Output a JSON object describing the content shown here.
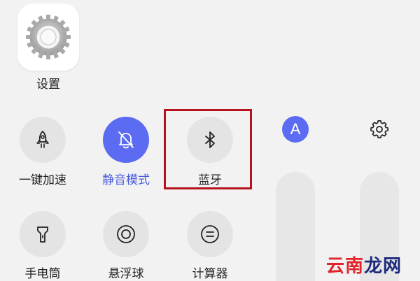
{
  "app": {
    "label": "设置",
    "icon": "settings-gear-icon"
  },
  "tiles": [
    {
      "label": "一键加速",
      "icon": "rocket-icon",
      "active": false
    },
    {
      "label": "静音模式",
      "icon": "bell-off-icon",
      "active": true
    },
    {
      "label": "蓝牙",
      "icon": "bluetooth-icon",
      "active": false,
      "highlighted": true
    },
    {
      "label": "手电筒",
      "icon": "flashlight-icon",
      "active": false
    },
    {
      "label": "悬浮球",
      "icon": "floating-ball-icon",
      "active": false
    },
    {
      "label": "计算器",
      "icon": "calculator-icon",
      "active": false
    }
  ],
  "sliders": {
    "auto_brightness_badge": "A",
    "volume_settings_icon": "gear-icon"
  },
  "watermark": {
    "part1": "云南",
    "part2": "龙网"
  },
  "colors": {
    "accent": "#5c6cf2",
    "highlight_border": "#b5141e",
    "tile_bg": "#e4e4e4"
  }
}
